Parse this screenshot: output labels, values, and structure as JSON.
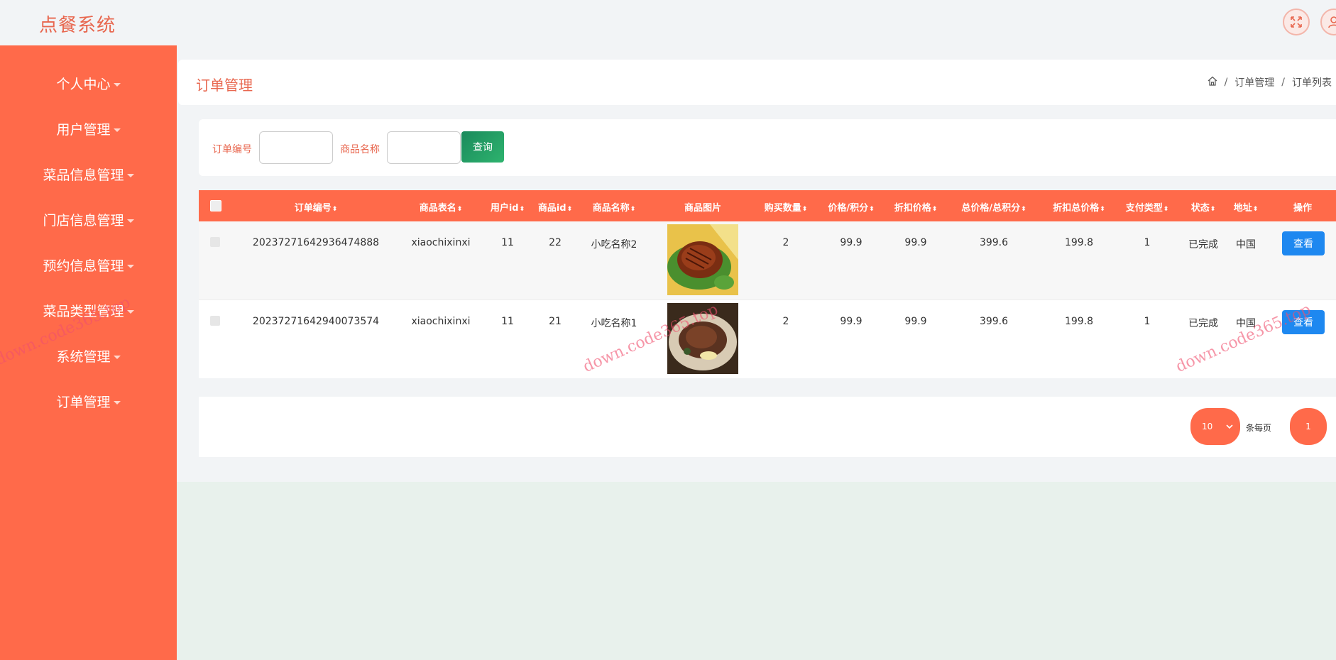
{
  "app": {
    "title": "点餐系统"
  },
  "sidebar": {
    "items": [
      {
        "label": "个人中心"
      },
      {
        "label": "用户管理"
      },
      {
        "label": "菜品信息管理"
      },
      {
        "label": "门店信息管理"
      },
      {
        "label": "预约信息管理"
      },
      {
        "label": "菜品类型管理"
      },
      {
        "label": "系统管理"
      },
      {
        "label": "订单管理"
      }
    ]
  },
  "header": {
    "title": "订单管理",
    "breadcrumb": [
      "订单管理",
      "订单列表"
    ]
  },
  "search": {
    "order_no_label": "订单编号",
    "order_no_value": "",
    "product_name_label": "商品名称",
    "product_name_value": "",
    "button_label": "查询"
  },
  "table": {
    "columns": [
      "订单编号",
      "商品表名",
      "用户id",
      "商品id",
      "商品名称",
      "商品图片",
      "购买数量",
      "价格/积分",
      "折扣价格",
      "总价格/总积分",
      "折扣总价格",
      "支付类型",
      "状态",
      "地址",
      "操作"
    ],
    "rows": [
      {
        "order_no": "20237271642936474888",
        "table_name": "xiaochixinxi",
        "user_id": "11",
        "product_id": "22",
        "product_name": "小吃名称2",
        "quantity": "2",
        "price": "99.9",
        "discount_price": "99.9",
        "total": "399.6",
        "discount_total": "199.8",
        "pay_type": "1",
        "status": "已完成",
        "address": "中国",
        "action": "查看"
      },
      {
        "order_no": "20237271642940073574",
        "table_name": "xiaochixinxi",
        "user_id": "11",
        "product_id": "21",
        "product_name": "小吃名称1",
        "quantity": "2",
        "price": "99.9",
        "discount_price": "99.9",
        "total": "399.6",
        "discount_total": "199.8",
        "pay_type": "1",
        "status": "已完成",
        "address": "中国",
        "action": "查看"
      }
    ]
  },
  "pagination": {
    "page_size": "10",
    "per_page_label": "条每页",
    "current_page": "1"
  },
  "watermark": {
    "text": "down.code365.top"
  },
  "colors": {
    "accent": "#ff6a4a",
    "primary_text": "#e8674f",
    "view_button": "#1e88f0",
    "search_button": "#1a8a5c"
  }
}
